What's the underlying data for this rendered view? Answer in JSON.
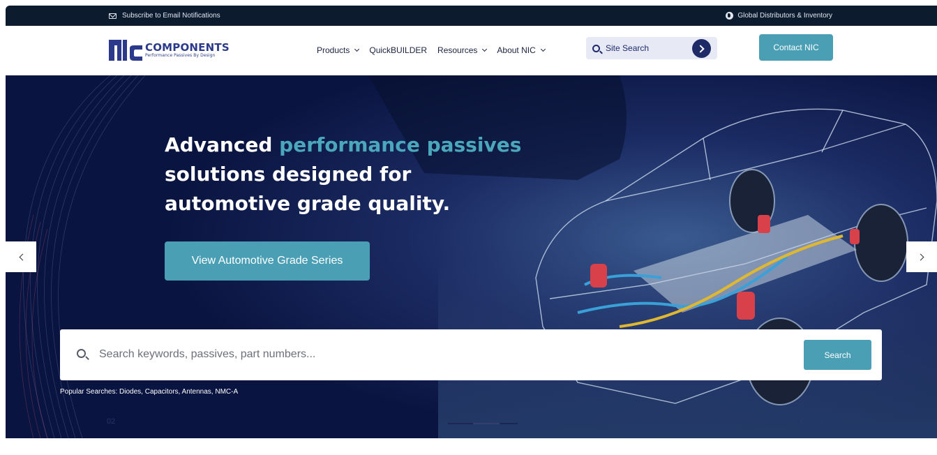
{
  "topbar": {
    "subscribe_label": "Subscribe to Email Notifications",
    "subscribe_icon": "mail-icon",
    "distributors_label": "Global Distributors & Inventory",
    "distributors_icon": "globe-icon"
  },
  "header": {
    "logo": {
      "brand": "COMPONENTS",
      "tagline": "Performance Passives By Design"
    },
    "nav": [
      {
        "label": "Products",
        "has_dropdown": true
      },
      {
        "label": "QuickBUILDER",
        "has_dropdown": false
      },
      {
        "label": "Resources",
        "has_dropdown": true
      },
      {
        "label": "About NIC",
        "has_dropdown": true
      }
    ],
    "site_search": {
      "placeholder": "Site Search"
    },
    "contact_label": "Contact NIC"
  },
  "hero": {
    "headline_prefix": "Advanced ",
    "headline_accent": "performance passives",
    "headline_suffix": " solutions designed for automotive grade quality.",
    "cta_label": "View Automotive Grade Series",
    "search_placeholder": "Search keywords, passives, part numbers...",
    "search_button": "Search",
    "popular_searches": "Popular Searches: Diodes, Capacitors, Antennas, NMC-A",
    "slide_number": "02"
  },
  "colors": {
    "accent": "#4a9fb5",
    "navy": "#1f2b66",
    "topbar": "#0d1b2e",
    "hero": "#0c1640"
  }
}
